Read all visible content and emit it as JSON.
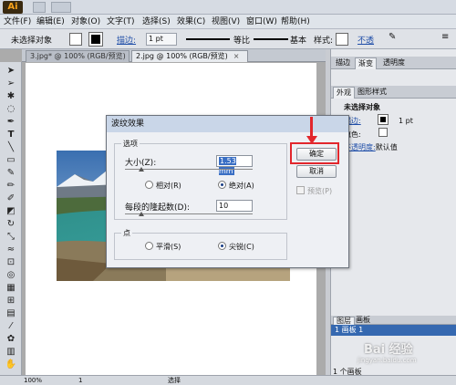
{
  "app": {
    "logo": "Ai"
  },
  "menu": [
    "文件(F)",
    "编辑(E)",
    "对象(O)",
    "文字(T)",
    "选择(S)",
    "效果(C)",
    "视图(V)",
    "窗口(W)",
    "帮助(H)"
  ],
  "control_bar": {
    "selection_status": "未选择对象",
    "stroke_label": "描边:",
    "stroke_weight": "1 pt",
    "profile_label": "等比",
    "brush_label": "基本",
    "style_label": "样式:",
    "opacity_link": "不透"
  },
  "doc_tabs": [
    {
      "label": "3.jpg* @ 100% (RGB/预览)",
      "active": false
    },
    {
      "label": "2.jpg @ 100% (RGB/预览)",
      "active": true
    }
  ],
  "panel": {
    "top_tabs": [
      "描边",
      "渐变",
      "透明度"
    ],
    "appearance_tabs": [
      "外观",
      "图形样式"
    ],
    "no_selection": "未选择对象",
    "stroke_label": "描边:",
    "stroke_value": "1 pt",
    "fill_label": "填色:",
    "opacity_label": "不透明度:",
    "opacity_value": "默认值",
    "layers_tabs": [
      "图层",
      "画板"
    ],
    "artboard_row": "1   画板 1",
    "layers_count": "1 个画板"
  },
  "status_bar": {
    "zoom": "100%",
    "page": "1",
    "tool": "选择"
  },
  "dialog": {
    "title": "波纹效果",
    "options_group": "选项",
    "size_label": "大小(Z):",
    "size_value": "1.53 mm",
    "relative_label": "相对(R)",
    "absolute_label": "绝对(A)",
    "absolute_selected": true,
    "ridges_label": "每段的隆起数(D):",
    "ridges_value": "10",
    "point_group": "点",
    "smooth_label": "平滑(S)",
    "corner_label": "尖锐(C)",
    "corner_selected": true,
    "ok_label": "确定",
    "cancel_label": "取消",
    "preview_label": "预览(P)"
  },
  "watermark": {
    "brand": "Bai 经验",
    "url": "jingyan.baidu.com"
  },
  "colors": {
    "highlight": "#e2262c",
    "selection_blue": "#3a6fc4",
    "title_blue": "#c9d6e8"
  }
}
